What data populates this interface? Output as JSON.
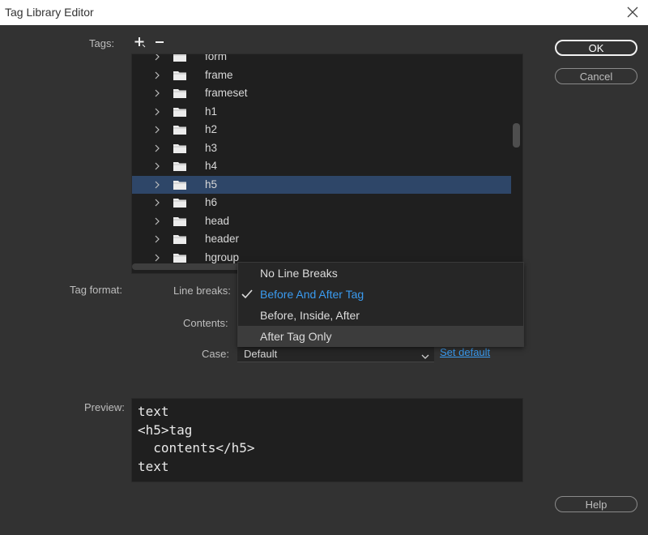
{
  "window": {
    "title": "Tag Library Editor"
  },
  "labels": {
    "tags": "Tags:",
    "tag_format": "Tag format:",
    "line_breaks": "Line breaks:",
    "contents": "Contents:",
    "case": "Case:",
    "preview": "Preview:"
  },
  "buttons": {
    "ok": "OK",
    "cancel": "Cancel",
    "help": "Help"
  },
  "tree": {
    "items": [
      {
        "label": "form"
      },
      {
        "label": "frame"
      },
      {
        "label": "frameset"
      },
      {
        "label": "h1"
      },
      {
        "label": "h2"
      },
      {
        "label": "h3"
      },
      {
        "label": "h4"
      },
      {
        "label": "h5",
        "selected": true
      },
      {
        "label": "h6"
      },
      {
        "label": "head"
      },
      {
        "label": "header"
      },
      {
        "label": "hgroup"
      }
    ]
  },
  "line_breaks_dropdown": {
    "options": [
      {
        "label": "No Line Breaks"
      },
      {
        "label": "Before And After Tag",
        "checked": true
      },
      {
        "label": "Before, Inside, After"
      },
      {
        "label": "After Tag Only",
        "hover": true
      }
    ]
  },
  "case": {
    "value": "Default",
    "set_default": "Set default"
  },
  "preview": {
    "lines": [
      "text",
      "<h5>tag",
      "  contents</h5>",
      "text"
    ]
  },
  "icons": {
    "add": "plus-icon",
    "remove": "minus-icon",
    "close": "close-icon",
    "folder": "folder-icon",
    "chevron": "chevron-right-icon",
    "check": "checkmark-icon"
  },
  "colors": {
    "accent": "#3a9bf0",
    "selection": "#2e4668",
    "background": "#323232"
  }
}
